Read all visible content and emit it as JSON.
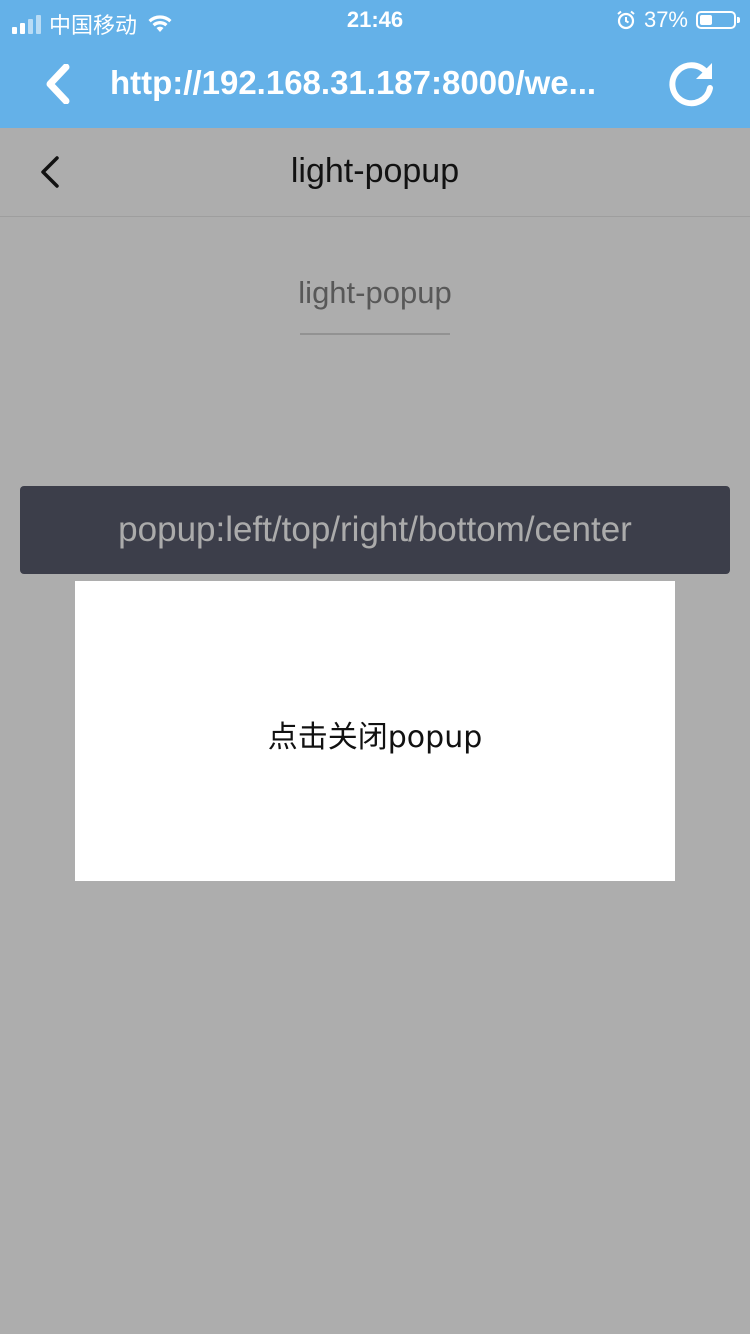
{
  "status_bar": {
    "carrier": "中国移动",
    "time": "21:46",
    "battery_percent": "37%",
    "battery_level": 0.37
  },
  "browser": {
    "url": "http://192.168.31.187:8000/we..."
  },
  "navbar": {
    "title": "light-popup"
  },
  "page": {
    "heading": "light-popup",
    "demo_button_label": "popup:left/top/right/bottom/center"
  },
  "popup": {
    "text": "点击关闭popup"
  },
  "colors": {
    "browser_bar": "#64b1e8",
    "button": "#575a6b",
    "mask": "rgba(0,0,0,0.3)"
  }
}
